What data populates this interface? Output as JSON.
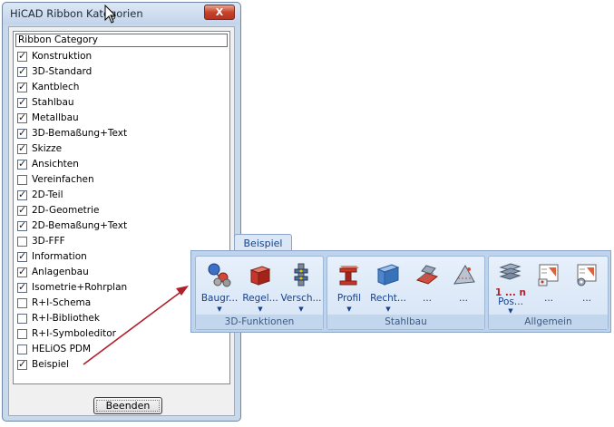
{
  "dialog": {
    "title": "HiCAD Ribbon Kategorien",
    "close_glyph": "X",
    "header": "Ribbon Category",
    "items": [
      {
        "label": "Konstruktion",
        "checked": true
      },
      {
        "label": "3D-Standard",
        "checked": true
      },
      {
        "label": "Kantblech",
        "checked": true
      },
      {
        "label": "Stahlbau",
        "checked": true
      },
      {
        "label": "Metallbau",
        "checked": true
      },
      {
        "label": "3D-Bemaßung+Text",
        "checked": true
      },
      {
        "label": "Skizze",
        "checked": true
      },
      {
        "label": "Ansichten",
        "checked": true
      },
      {
        "label": "Vereinfachen",
        "checked": false
      },
      {
        "label": "2D-Teil",
        "checked": true
      },
      {
        "label": "2D-Geometrie",
        "checked": true
      },
      {
        "label": "2D-Bemaßung+Text",
        "checked": true
      },
      {
        "label": "3D-FFF",
        "checked": false
      },
      {
        "label": "Information",
        "checked": true
      },
      {
        "label": "Anlagenbau",
        "checked": true
      },
      {
        "label": "Isometrie+Rohrplan",
        "checked": true
      },
      {
        "label": "R+I-Schema",
        "checked": false
      },
      {
        "label": "R+I-Bibliothek",
        "checked": false
      },
      {
        "label": "R+I-Symboleditor",
        "checked": false
      },
      {
        "label": "HELiOS PDM",
        "checked": false
      },
      {
        "label": "Beispiel",
        "checked": true
      }
    ],
    "ok_button": "Beenden"
  },
  "ribbon": {
    "tab": "Beispiel",
    "groups": [
      {
        "title": "3D-Funktionen",
        "buttons": [
          "Baugr...",
          "Regel...",
          "Versch..."
        ]
      },
      {
        "title": "Stahlbau",
        "buttons": [
          "Profil",
          "Recht...",
          "...",
          "..."
        ]
      },
      {
        "title": "Allgemein",
        "buttons": [
          "Pos...",
          "...",
          "..."
        ]
      }
    ],
    "pos_icon_text": "1 ... n"
  },
  "colors": {
    "arrow": "#b0202a",
    "ribbon_text": "#15428b"
  }
}
